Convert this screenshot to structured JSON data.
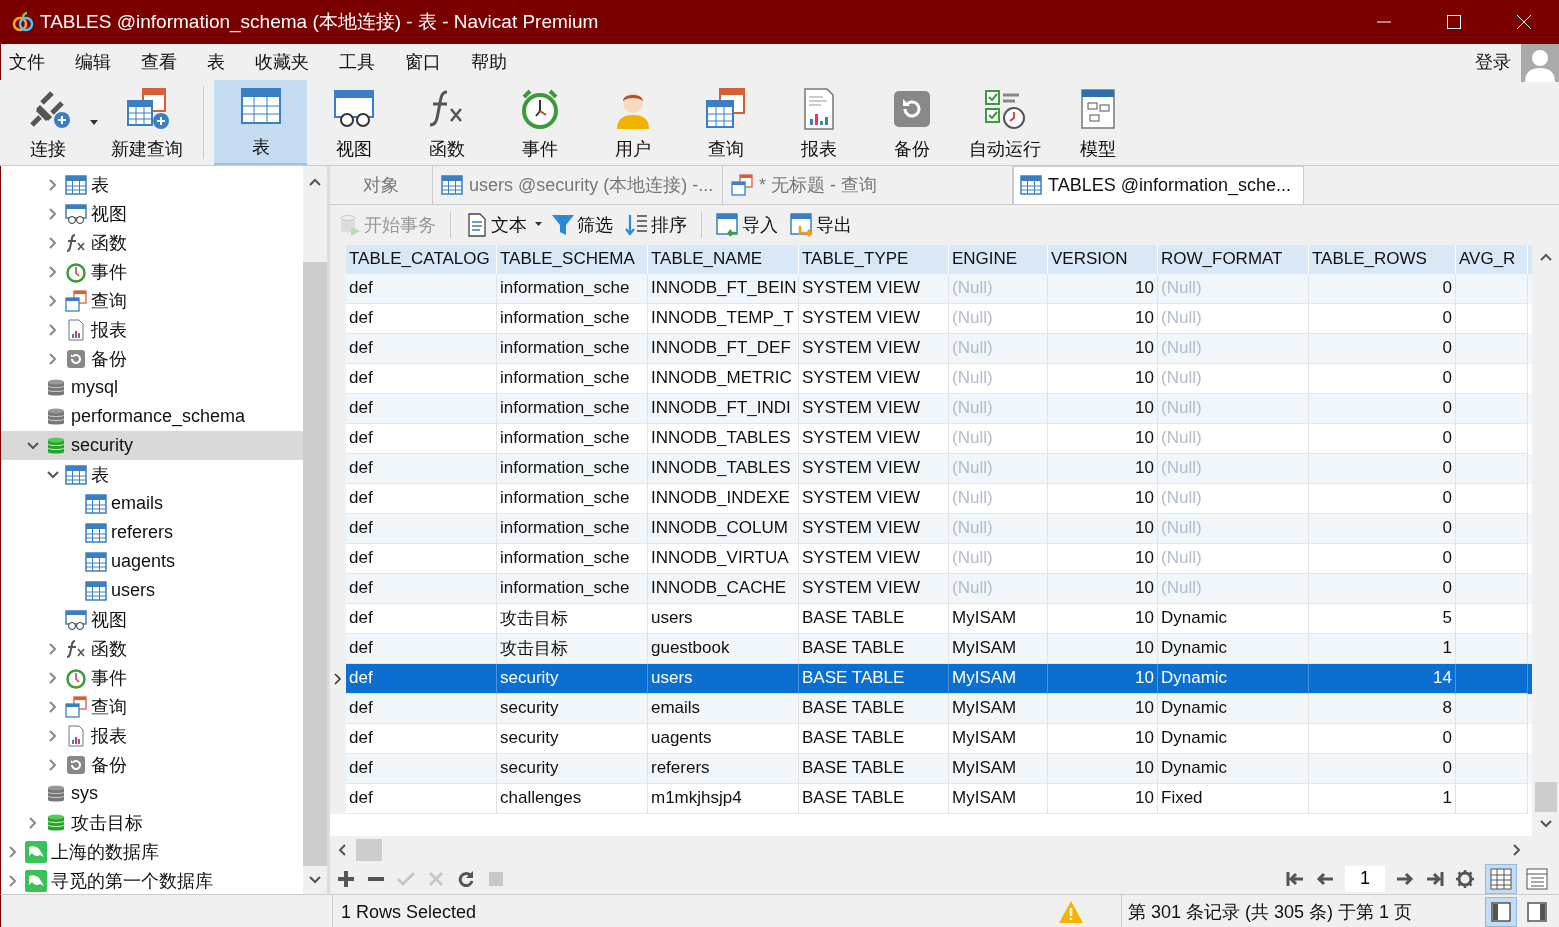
{
  "window": {
    "title": "TABLES @information_schema (本地连接) - 表 - Navicat Premium"
  },
  "menu": [
    "文件",
    "编辑",
    "查看",
    "表",
    "收藏夹",
    "工具",
    "窗口",
    "帮助"
  ],
  "login": "登录",
  "toolbar": [
    {
      "label": "连接",
      "kind": "connect",
      "selected": false,
      "dropdown": true
    },
    {
      "label": "新建查询",
      "kind": "new-query",
      "selected": false
    },
    {
      "label": "表",
      "kind": "table",
      "selected": true
    },
    {
      "label": "视图",
      "kind": "view",
      "selected": false
    },
    {
      "label": "函数",
      "kind": "function",
      "selected": false
    },
    {
      "label": "事件",
      "kind": "event",
      "selected": false
    },
    {
      "label": "用户",
      "kind": "user",
      "selected": false
    },
    {
      "label": "查询",
      "kind": "query",
      "selected": false
    },
    {
      "label": "报表",
      "kind": "report",
      "selected": false
    },
    {
      "label": "备份",
      "kind": "backup",
      "selected": false
    },
    {
      "label": "自动运行",
      "kind": "automation",
      "selected": false
    },
    {
      "label": "模型",
      "kind": "model",
      "selected": false
    }
  ],
  "tree": [
    {
      "children": [
        {
          "children": [
            {
              "label": "表",
              "kind": "tables",
              "expanded": false,
              "selected": false
            },
            {
              "label": "视图",
              "kind": "views",
              "expanded": false,
              "selected": false
            },
            {
              "label": "函数",
              "kind": "functions",
              "expanded": false,
              "selected": false
            },
            {
              "label": "事件",
              "kind": "events",
              "expanded": false,
              "selected": false
            },
            {
              "label": "查询",
              "kind": "queries",
              "expanded": false,
              "selected": false
            },
            {
              "label": "报表",
              "kind": "reports",
              "expanded": false,
              "selected": false
            },
            {
              "label": "备份",
              "kind": "backups",
              "expanded": false,
              "selected": false
            }
          ]
        },
        {
          "label": "mysql",
          "kind": "database",
          "selected": false
        },
        {
          "label": "performance_schema",
          "kind": "database",
          "selected": false
        },
        {
          "label": "security",
          "kind": "database-open",
          "expanded": true,
          "selected": true,
          "children": [
            {
              "label": "表",
              "kind": "tables",
              "expanded": true,
              "selected": false,
              "children": [
                {
                  "label": "emails",
                  "kind": "table",
                  "selected": false
                },
                {
                  "label": "referers",
                  "kind": "table",
                  "selected": false
                },
                {
                  "label": "uagents",
                  "kind": "table",
                  "selected": false
                },
                {
                  "label": "users",
                  "kind": "table",
                  "selected": false
                }
              ]
            },
            {
              "label": "视图",
              "kind": "views",
              "selected": false
            },
            {
              "label": "函数",
              "kind": "functions",
              "expanded": false,
              "selected": false
            },
            {
              "label": "事件",
              "kind": "events",
              "expanded": false,
              "selected": false
            },
            {
              "label": "查询",
              "kind": "queries",
              "expanded": false,
              "selected": false
            },
            {
              "label": "报表",
              "kind": "reports",
              "expanded": false,
              "selected": false
            },
            {
              "label": "备份",
              "kind": "backups",
              "expanded": false,
              "selected": false
            }
          ]
        },
        {
          "label": "sys",
          "kind": "database",
          "selected": false
        },
        {
          "label": "攻击目标",
          "kind": "database-open",
          "expanded": false,
          "selected": false
        }
      ]
    },
    {
      "label": "上海的数据库",
      "kind": "connection",
      "expanded": false,
      "selected": false
    },
    {
      "label": "寻觅的第一个数据库",
      "kind": "connection",
      "expanded": false,
      "selected": false
    }
  ],
  "tabs": [
    {
      "label": "对象",
      "kind": "objects",
      "selected": false
    },
    {
      "label": "users @security (本地连接) -...",
      "kind": "table",
      "selected": false
    },
    {
      "label": "* 无标题 - 查询",
      "kind": "query",
      "selected": false
    },
    {
      "label": "TABLES @information_sche...",
      "kind": "table",
      "selected": true
    }
  ],
  "actions": [
    {
      "label": "开始事务",
      "kind": "transaction",
      "disabled": true
    },
    {
      "label": "文本",
      "kind": "text",
      "disabled": false,
      "dropdown": true
    },
    {
      "label": "筛选",
      "kind": "filter",
      "disabled": false
    },
    {
      "label": "排序",
      "kind": "sort",
      "disabled": false
    },
    {
      "label": "导入",
      "kind": "import",
      "disabled": false
    },
    {
      "label": "导出",
      "kind": "export",
      "disabled": false
    }
  ],
  "table": {
    "columns": [
      {
        "label": "TABLE_CATALOG",
        "kind": "text"
      },
      {
        "label": "TABLE_SCHEMA",
        "kind": "text"
      },
      {
        "label": "TABLE_NAME",
        "kind": "text"
      },
      {
        "label": "TABLE_TYPE",
        "kind": "text"
      },
      {
        "label": "ENGINE",
        "kind": "text"
      },
      {
        "label": "VERSION",
        "kind": "number"
      },
      {
        "label": "ROW_FORMAT",
        "kind": "text"
      },
      {
        "label": "TABLE_ROWS",
        "kind": "number"
      },
      {
        "label": "AVG_R",
        "kind": "text"
      }
    ],
    "rows": [
      {
        "selected": false,
        "cells": [
          {
            "text": "def"
          },
          {
            "text": "information_sche"
          },
          {
            "text": "INNODB_FT_BEIN"
          },
          {
            "text": "SYSTEM VIEW"
          },
          {
            "text": "(Null)",
            "null": true
          },
          {
            "text": "10"
          },
          {
            "text": "(Null)",
            "null": true
          },
          {
            "text": "0"
          }
        ]
      },
      {
        "selected": false,
        "cells": [
          {
            "text": "def"
          },
          {
            "text": "information_sche"
          },
          {
            "text": "INNODB_TEMP_T"
          },
          {
            "text": "SYSTEM VIEW"
          },
          {
            "text": "(Null)",
            "null": true
          },
          {
            "text": "10"
          },
          {
            "text": "(Null)",
            "null": true
          },
          {
            "text": "0"
          }
        ]
      },
      {
        "selected": false,
        "cells": [
          {
            "text": "def"
          },
          {
            "text": "information_sche"
          },
          {
            "text": "INNODB_FT_DEF"
          },
          {
            "text": "SYSTEM VIEW"
          },
          {
            "text": "(Null)",
            "null": true
          },
          {
            "text": "10"
          },
          {
            "text": "(Null)",
            "null": true
          },
          {
            "text": "0"
          }
        ]
      },
      {
        "selected": false,
        "cells": [
          {
            "text": "def"
          },
          {
            "text": "information_sche"
          },
          {
            "text": "INNODB_METRIC"
          },
          {
            "text": "SYSTEM VIEW"
          },
          {
            "text": "(Null)",
            "null": true
          },
          {
            "text": "10"
          },
          {
            "text": "(Null)",
            "null": true
          },
          {
            "text": "0"
          }
        ]
      },
      {
        "selected": false,
        "cells": [
          {
            "text": "def"
          },
          {
            "text": "information_sche"
          },
          {
            "text": "INNODB_FT_INDI"
          },
          {
            "text": "SYSTEM VIEW"
          },
          {
            "text": "(Null)",
            "null": true
          },
          {
            "text": "10"
          },
          {
            "text": "(Null)",
            "null": true
          },
          {
            "text": "0"
          }
        ]
      },
      {
        "selected": false,
        "cells": [
          {
            "text": "def"
          },
          {
            "text": "information_sche"
          },
          {
            "text": "INNODB_TABLES"
          },
          {
            "text": "SYSTEM VIEW"
          },
          {
            "text": "(Null)",
            "null": true
          },
          {
            "text": "10"
          },
          {
            "text": "(Null)",
            "null": true
          },
          {
            "text": "0"
          }
        ]
      },
      {
        "selected": false,
        "cells": [
          {
            "text": "def"
          },
          {
            "text": "information_sche"
          },
          {
            "text": "INNODB_TABLES"
          },
          {
            "text": "SYSTEM VIEW"
          },
          {
            "text": "(Null)",
            "null": true
          },
          {
            "text": "10"
          },
          {
            "text": "(Null)",
            "null": true
          },
          {
            "text": "0"
          }
        ]
      },
      {
        "selected": false,
        "cells": [
          {
            "text": "def"
          },
          {
            "text": "information_sche"
          },
          {
            "text": "INNODB_INDEXE"
          },
          {
            "text": "SYSTEM VIEW"
          },
          {
            "text": "(Null)",
            "null": true
          },
          {
            "text": "10"
          },
          {
            "text": "(Null)",
            "null": true
          },
          {
            "text": "0"
          }
        ]
      },
      {
        "selected": false,
        "cells": [
          {
            "text": "def"
          },
          {
            "text": "information_sche"
          },
          {
            "text": "INNODB_COLUM"
          },
          {
            "text": "SYSTEM VIEW"
          },
          {
            "text": "(Null)",
            "null": true
          },
          {
            "text": "10"
          },
          {
            "text": "(Null)",
            "null": true
          },
          {
            "text": "0"
          }
        ]
      },
      {
        "selected": false,
        "cells": [
          {
            "text": "def"
          },
          {
            "text": "information_sche"
          },
          {
            "text": "INNODB_VIRTUA"
          },
          {
            "text": "SYSTEM VIEW"
          },
          {
            "text": "(Null)",
            "null": true
          },
          {
            "text": "10"
          },
          {
            "text": "(Null)",
            "null": true
          },
          {
            "text": "0"
          }
        ]
      },
      {
        "selected": false,
        "cells": [
          {
            "text": "def"
          },
          {
            "text": "information_sche"
          },
          {
            "text": "INNODB_CACHE"
          },
          {
            "text": "SYSTEM VIEW"
          },
          {
            "text": "(Null)",
            "null": true
          },
          {
            "text": "10"
          },
          {
            "text": "(Null)",
            "null": true
          },
          {
            "text": "0"
          }
        ]
      },
      {
        "selected": false,
        "cells": [
          {
            "text": "def"
          },
          {
            "text": "攻击目标"
          },
          {
            "text": "users"
          },
          {
            "text": "BASE TABLE"
          },
          {
            "text": "MyISAM"
          },
          {
            "text": "10"
          },
          {
            "text": "Dynamic"
          },
          {
            "text": "5"
          }
        ]
      },
      {
        "selected": false,
        "cells": [
          {
            "text": "def"
          },
          {
            "text": "攻击目标"
          },
          {
            "text": "guestbook"
          },
          {
            "text": "BASE TABLE"
          },
          {
            "text": "MyISAM"
          },
          {
            "text": "10"
          },
          {
            "text": "Dynamic"
          },
          {
            "text": "1"
          }
        ]
      },
      {
        "selected": true,
        "cells": [
          {
            "text": "def"
          },
          {
            "text": "security"
          },
          {
            "text": "users"
          },
          {
            "text": "BASE TABLE"
          },
          {
            "text": "MyISAM"
          },
          {
            "text": "10"
          },
          {
            "text": "Dynamic"
          },
          {
            "text": "14"
          }
        ]
      },
      {
        "selected": false,
        "cells": [
          {
            "text": "def"
          },
          {
            "text": "security"
          },
          {
            "text": "emails"
          },
          {
            "text": "BASE TABLE"
          },
          {
            "text": "MyISAM"
          },
          {
            "text": "10"
          },
          {
            "text": "Dynamic"
          },
          {
            "text": "8"
          }
        ]
      },
      {
        "selected": false,
        "cells": [
          {
            "text": "def"
          },
          {
            "text": "security"
          },
          {
            "text": "uagents"
          },
          {
            "text": "BASE TABLE"
          },
          {
            "text": "MyISAM"
          },
          {
            "text": "10"
          },
          {
            "text": "Dynamic"
          },
          {
            "text": "0"
          }
        ]
      },
      {
        "selected": false,
        "cells": [
          {
            "text": "def"
          },
          {
            "text": "security"
          },
          {
            "text": "referers"
          },
          {
            "text": "BASE TABLE"
          },
          {
            "text": "MyISAM"
          },
          {
            "text": "10"
          },
          {
            "text": "Dynamic"
          },
          {
            "text": "0"
          }
        ]
      },
      {
        "selected": false,
        "cells": [
          {
            "text": "def"
          },
          {
            "text": "challenges"
          },
          {
            "text": "m1mkjhsjp4"
          },
          {
            "text": "BASE TABLE"
          },
          {
            "text": "MyISAM"
          },
          {
            "text": "10"
          },
          {
            "text": "Fixed"
          },
          {
            "text": "1"
          }
        ]
      }
    ]
  },
  "record_tools": [
    {
      "kind": "add",
      "disabled": false
    },
    {
      "kind": "delete",
      "disabled": false
    },
    {
      "kind": "apply",
      "disabled": true
    },
    {
      "kind": "discard",
      "disabled": true
    },
    {
      "kind": "refresh",
      "disabled": false
    },
    {
      "kind": "stop",
      "disabled": true
    }
  ],
  "pager": {
    "page": "1"
  },
  "views": [
    {
      "kind": "grid",
      "selected": true
    },
    {
      "kind": "form",
      "selected": false
    }
  ],
  "status_bar": {
    "selection": "1 Rows Selected",
    "warning": true,
    "record_info": "第 301 条记录 (共 305 条) 于第 1 页",
    "panes": [
      {
        "kind": "left",
        "selected": true
      },
      {
        "kind": "right",
        "selected": false
      }
    ]
  }
}
